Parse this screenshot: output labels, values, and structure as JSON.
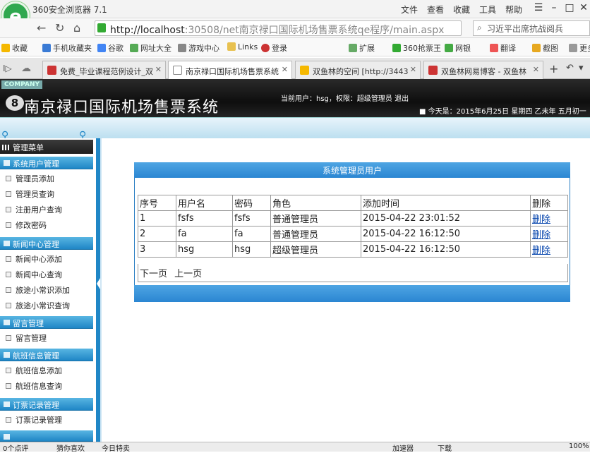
{
  "browser": {
    "app_title": "360安全浏览器 7.1",
    "menu": [
      "文件",
      "查看",
      "收藏",
      "工具",
      "帮助"
    ],
    "address_host": "http://localhost",
    "address_rest": ":30508/net南京禄口国际机场售票系统qe程序/main.aspx",
    "search_text": "习近平出席抗战阅兵",
    "favorites": [
      "收藏",
      "手机收藏夹",
      "谷歌",
      "网址大全",
      "游戏中心",
      "Links",
      "登录",
      "扩展",
      "360抢票王",
      "网银",
      "翻译",
      "截图",
      "更多"
    ],
    "tabs": [
      {
        "label": "免费_毕业课程范例设计_双",
        "active": false
      },
      {
        "label": "南京禄口国际机场售票系统",
        "active": true
      },
      {
        "label": "双鱼林的空间 [http://3443",
        "active": false
      },
      {
        "label": "双鱼林网易博客 - 双鱼林",
        "active": false
      }
    ]
  },
  "header": {
    "company": "COMPANY",
    "system_name": "南京禄口国际机场售票系统",
    "user_info": "当前用户：hsg，权限：超级管理员    退出",
    "date_info": "■ 今天是：2015年6月25日 星期四 乙未年 五月初一"
  },
  "sidebar": {
    "title": "管理菜单",
    "sections": [
      {
        "title": "系统用户管理",
        "items": [
          "管理员添加",
          "管理员查询",
          "注册用户查询",
          "修改密码"
        ]
      },
      {
        "title": "新闻中心管理",
        "items": [
          "新闻中心添加",
          "新闻中心查询",
          "旅途小常识添加",
          "旅途小常识查询"
        ]
      },
      {
        "title": "留言管理",
        "items": [
          "留言管理"
        ]
      },
      {
        "title": "航班信息管理",
        "items": [
          "航班信息添加",
          "航班信息查询"
        ]
      },
      {
        "title": "订票记录管理",
        "items": [
          "订票记录管理"
        ]
      }
    ]
  },
  "panel": {
    "title": "系统管理员用户",
    "columns": [
      "序号",
      "用户名",
      "密码",
      "角色",
      "添加时间",
      "删除"
    ],
    "rows": [
      {
        "no": "1",
        "username": "fsfs",
        "password": "fsfs",
        "role": "普通管理员",
        "added": "2015-04-22 23:01:52",
        "action": "删除"
      },
      {
        "no": "2",
        "username": "fa",
        "password": "fa",
        "role": "普通管理员",
        "added": "2015-04-22 16:12:50",
        "action": "删除"
      },
      {
        "no": "3",
        "username": "hsg",
        "password": "hsg",
        "role": "超级管理员",
        "added": "2015-04-22 16:12:50",
        "action": "删除"
      }
    ],
    "next_page": "下一页",
    "prev_page": "上一页"
  },
  "statusbar": {
    "left": "0个点评",
    "mid1": "猜你喜欢",
    "mid2": "今日特卖",
    "accel": "加速器",
    "download": "下载",
    "zoom": "100%"
  }
}
